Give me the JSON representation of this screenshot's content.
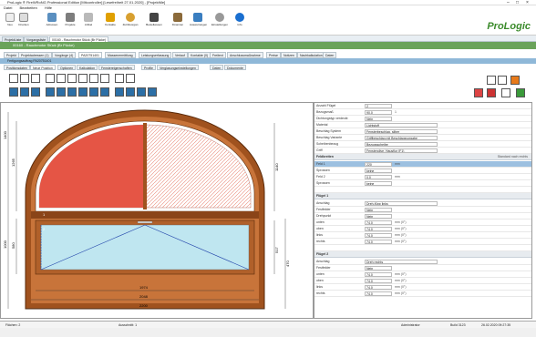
{
  "window": {
    "title": "ProLogic ® FireWRoNG Professional Edition [Mitcontroller] [Lesefreiheit 27.01.2020] - [ProjektMe]",
    "controls": [
      "–",
      "□",
      "×"
    ]
  },
  "menu": [
    "Datei",
    "Bearbeiten",
    "Hilfe"
  ],
  "ribbon": {
    "quick": [
      "Neu",
      "Drucken"
    ],
    "buttons": [
      "Adressen",
      "Projekte",
      "Artikel",
      "Kontakte",
      "Zutrittsorgan",
      "Bestellwesen",
      "Finanzen",
      "Auswertungen",
      "Einstellungen",
      "Info"
    ],
    "logo": "ProLogic"
  },
  "doctabs": [
    "ProjektListe",
    "Vorgangsliste",
    "00160 - Rauchmotor Stück (Br Pücke)"
  ],
  "greenbar": "00160 - Rauchmotor Stück (Br Pücke)",
  "subtabs": [
    "Projekt",
    "Projektadressen (1)",
    "Vorgänge (4)",
    "PA20751401",
    "Massenermittlung",
    "Leistungserfassung",
    "Verlauf",
    "Kontakte (0)",
    "Freitext",
    "Anschlussmaßnahme",
    "Preise",
    "Notizen",
    "Nachkalkulation",
    "Daten"
  ],
  "infobar": "Fertigungsauftrag PA20751401",
  "postabs": [
    "Positionsdaten",
    "Neue Position",
    "Optionen",
    "Kalkulation",
    "Fenstereigenschaften",
    "Profile",
    "Verglasungseinstellungen",
    "Daten",
    "Dokumente"
  ],
  "drawing": {
    "dims_bottom": [
      "1974",
      "2048",
      "2200"
    ],
    "dims_left": [
      "1400",
      "1265",
      "1000",
      "580"
    ],
    "dims_right": [
      "1140",
      "517",
      "470"
    ],
    "labels": [
      "1",
      "2"
    ]
  },
  "properties": [
    {
      "k": "Anzahl Flügel",
      "v": "2",
      "type": "row"
    },
    {
      "k": "Bezugsmaß",
      "v": "90,0",
      "u": "1",
      "type": "row"
    },
    {
      "k": "Dichtungstyp verdeckt",
      "v": "Nein",
      "type": "row"
    },
    {
      "k": "Material",
      "v": "Lichtstoff",
      "type": "roww"
    },
    {
      "k": "Beschlag System",
      "v": "Fensterbeschlag, silber",
      "type": "roww"
    },
    {
      "k": "Beschlag Variante",
      "v": "Griffbeschlag mit Beschlagsvorgabe",
      "type": "roww"
    },
    {
      "k": "Scheibenbezug",
      "v": "Bezugsscheibe",
      "type": "roww"
    },
    {
      "k": "Griff",
      "v": "Fensterolive, Hausflur (F1)",
      "type": "roww"
    },
    {
      "k": "Feldbreiten",
      "r": "Standard nach rechts",
      "type": "sec"
    },
    {
      "k": "Feld 1",
      "v": "220",
      "u": "mm",
      "type": "sel"
    },
    {
      "k": "Sprossen",
      "v": "keine",
      "type": "row"
    },
    {
      "k": "Feld 2",
      "v": "0,0",
      "u": "mm",
      "type": "row"
    },
    {
      "k": "Sprossen",
      "v": "keine",
      "type": "row"
    },
    {
      "k": "",
      "type": "blank"
    },
    {
      "k": "Flügel 1",
      "type": "sec"
    },
    {
      "k": "Anschlag",
      "v": "Dreh-Kipp links",
      "type": "roww"
    },
    {
      "k": "Festfelder",
      "v": "Nein",
      "type": "row"
    },
    {
      "k": "Drehpunkt",
      "v": "Nein",
      "type": "row"
    },
    {
      "k": "unten",
      "v": "74,0",
      "u": "mm (0°)",
      "type": "row"
    },
    {
      "k": "oben",
      "v": "74,0",
      "u": "mm (0°)",
      "type": "row"
    },
    {
      "k": "links",
      "v": "74,0",
      "u": "mm (0°)",
      "type": "row"
    },
    {
      "k": "rechts",
      "v": "74,0",
      "u": "mm (0°)",
      "type": "row"
    },
    {
      "k": "",
      "type": "blank"
    },
    {
      "k": "Flügel 2",
      "type": "sec"
    },
    {
      "k": "Anschlag",
      "v": "Dreh rechts",
      "type": "roww"
    },
    {
      "k": "Festfelder",
      "v": "Nein",
      "type": "row"
    },
    {
      "k": "unten",
      "v": "74,0",
      "u": "mm (0°)",
      "type": "row"
    },
    {
      "k": "oben",
      "v": "74,0",
      "u": "mm (0°)",
      "type": "row"
    },
    {
      "k": "links",
      "v": "74,0",
      "u": "mm (0°)",
      "type": "row"
    },
    {
      "k": "rechts",
      "v": "74,0",
      "u": "mm (0°)",
      "type": "row"
    }
  ],
  "status": {
    "left": "Flächen: 2",
    "mid": "Ausschnitt: 1",
    "user": "Administrator",
    "version": "Build 3123",
    "date": "26.02.2020 09:27:35"
  },
  "colors": {
    "accent": "#6aa35a",
    "glass_red": "#e55545",
    "glass_blue": "#bfe6f0",
    "frame": "#a0521e"
  }
}
